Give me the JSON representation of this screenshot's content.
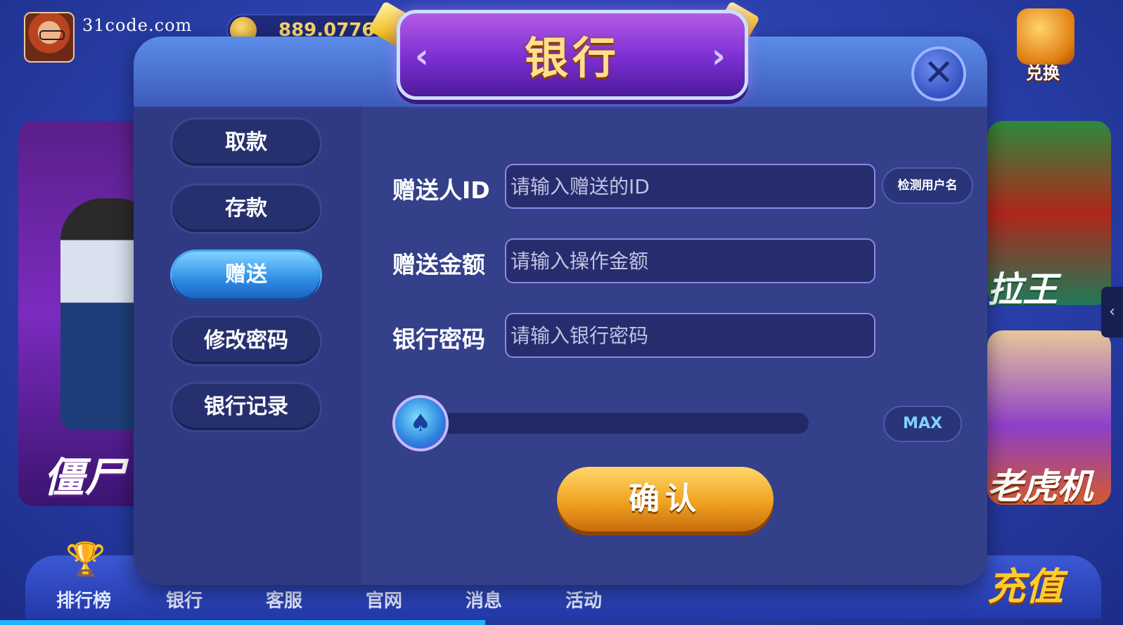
{
  "header": {
    "site_watermark": "31code.com",
    "coins": "889.0776",
    "exchange_label": "兑换"
  },
  "modal": {
    "title": "银行",
    "close_glyph": "✕",
    "menu": [
      {
        "label": "取款",
        "active": false
      },
      {
        "label": "存款",
        "active": false
      },
      {
        "label": "赠送",
        "active": true
      },
      {
        "label": "修改密码",
        "active": false
      },
      {
        "label": "银行记录",
        "active": false
      }
    ],
    "form": {
      "recipient_label": "赠送人ID",
      "recipient_placeholder": "请输入赠送的ID",
      "check_user_label": "检测用户名",
      "amount_label": "赠送金额",
      "amount_placeholder": "请输入操作金额",
      "password_label": "银行密码",
      "password_placeholder": "请输入银行密码",
      "slider_value": 0,
      "max_label": "MAX",
      "confirm_label": "确认"
    }
  },
  "games": {
    "left_label": "僵尸",
    "right_top_label": "拉王",
    "right_bottom_label": "老虎机"
  },
  "bottom_nav": {
    "items": [
      "排行榜",
      "银行",
      "客服",
      "官网",
      "消息",
      "活动"
    ],
    "recharge_label": "充值"
  },
  "icons": {
    "close": "close-icon",
    "spade": "spade-icon",
    "trophy": "trophy-icon",
    "side_tab": "chevron-left-icon"
  },
  "colors": {
    "accent_blue": "#2e8ee6",
    "gold": "#f0a321",
    "panel": "#33408f"
  }
}
